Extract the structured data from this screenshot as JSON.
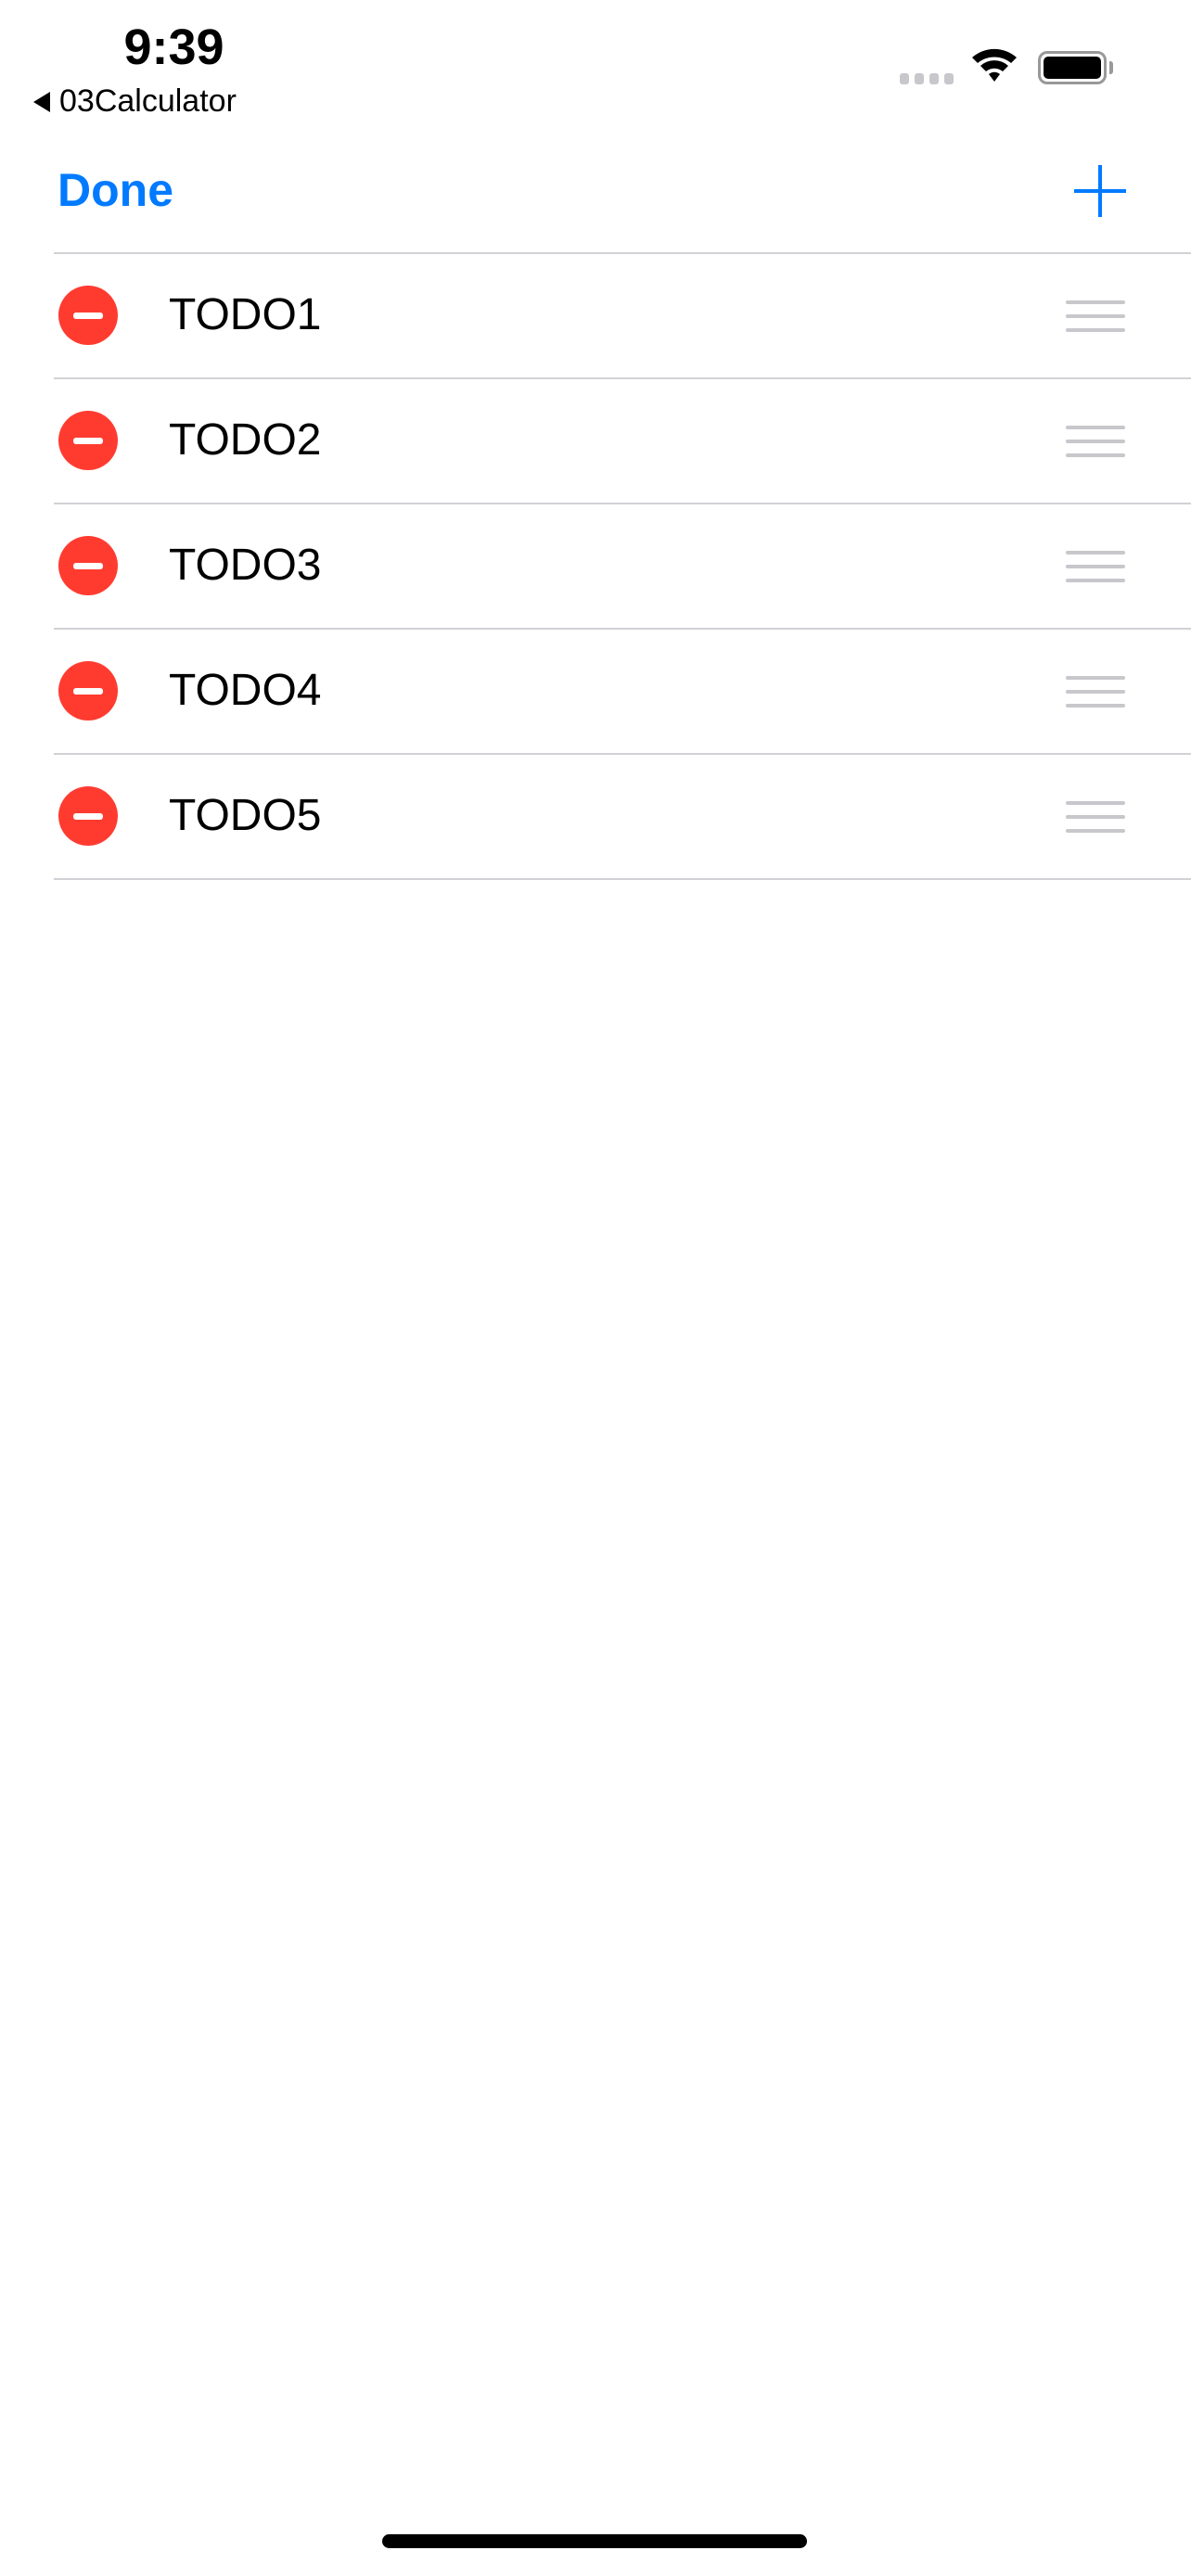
{
  "status_bar": {
    "time": "9:39",
    "back_app": "03Calculator",
    "icons": [
      "signal-icon",
      "wifi-icon",
      "battery-icon"
    ]
  },
  "nav": {
    "done_label": "Done",
    "add_icon": "plus-icon"
  },
  "items": [
    {
      "label": "TODO1"
    },
    {
      "label": "TODO2"
    },
    {
      "label": "TODO3"
    },
    {
      "label": "TODO4"
    },
    {
      "label": "TODO5"
    }
  ],
  "colors": {
    "accent": "#007AFF",
    "delete": "#FF3B30",
    "separator": "#d1d1d6"
  }
}
